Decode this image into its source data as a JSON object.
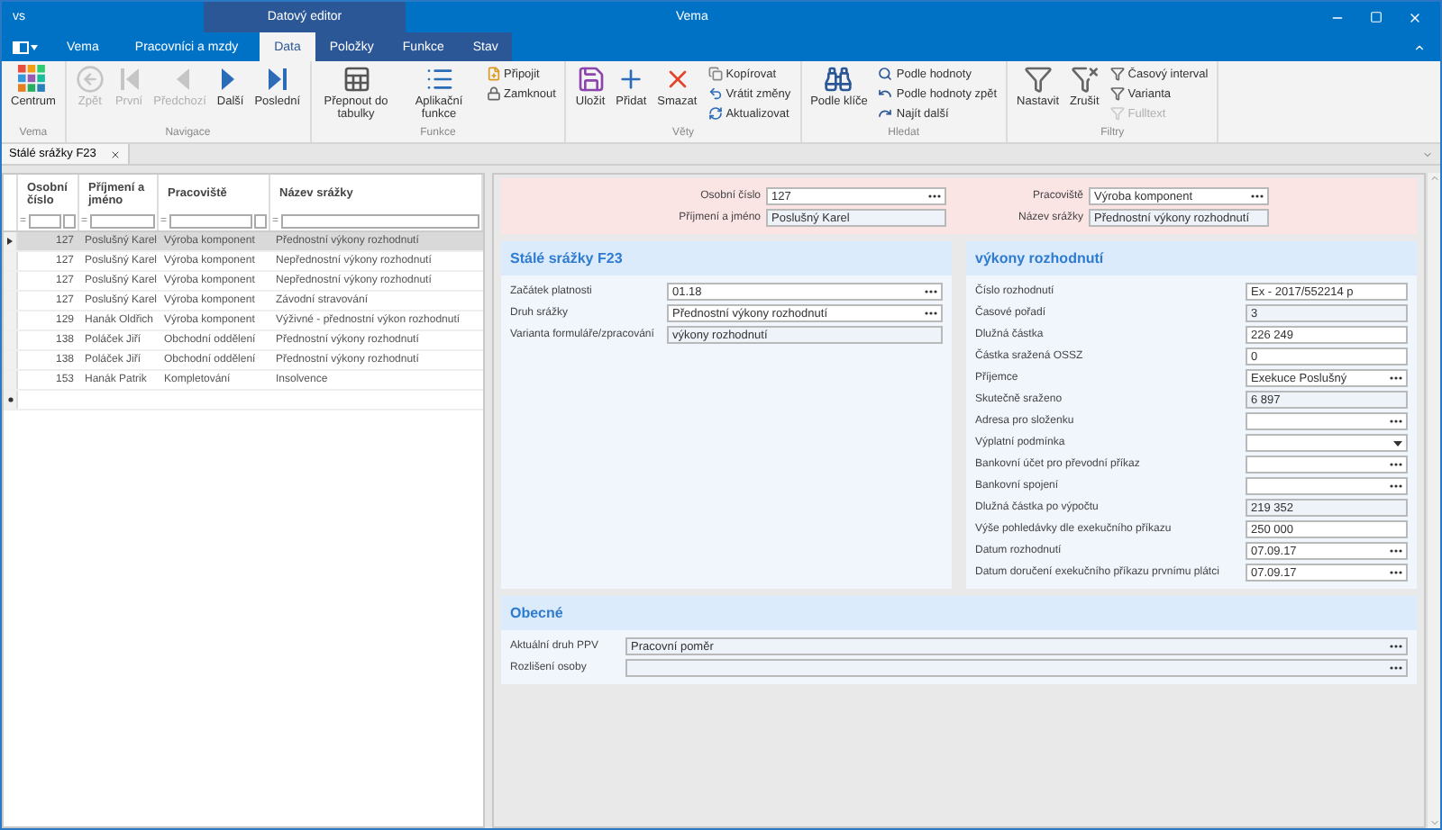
{
  "window": {
    "app": "vs",
    "title": "Vema",
    "context_group": "Datový editor"
  },
  "tabs": [
    {
      "label": "Vema",
      "selected": false,
      "contextual": false
    },
    {
      "label": "Pracovníci a mzdy",
      "selected": false,
      "contextual": false
    },
    {
      "label": "Data",
      "selected": true,
      "contextual": true
    },
    {
      "label": "Položky",
      "selected": false,
      "contextual": true
    },
    {
      "label": "Funkce",
      "selected": false,
      "contextual": true
    },
    {
      "label": "Stav",
      "selected": false,
      "contextual": true
    }
  ],
  "ribbon": [
    {
      "label": "Vema",
      "items": [
        {
          "kind": "large",
          "label": "Centrum",
          "disabled": false
        }
      ]
    },
    {
      "label": "Navigace",
      "items": [
        {
          "kind": "large",
          "label": "Zpět",
          "disabled": true
        },
        {
          "kind": "large",
          "label": "První",
          "disabled": true
        },
        {
          "kind": "large",
          "label": "Předchozí",
          "disabled": true
        },
        {
          "kind": "large",
          "label": "Další",
          "disabled": false
        },
        {
          "kind": "large",
          "label": "Poslední",
          "disabled": false
        }
      ]
    },
    {
      "label": "Funkce",
      "items": [
        {
          "kind": "large",
          "label": "Přepnout do tabulky",
          "disabled": false
        },
        {
          "kind": "large",
          "label": "Aplikační funkce",
          "disabled": false
        },
        {
          "kind": "small",
          "label": "Připojit",
          "disabled": false
        },
        {
          "kind": "small",
          "label": "Zamknout",
          "disabled": false
        }
      ]
    },
    {
      "label": "Věty",
      "items": [
        {
          "kind": "large",
          "label": "Uložit",
          "disabled": false
        },
        {
          "kind": "large",
          "label": "Přidat",
          "disabled": false
        },
        {
          "kind": "large",
          "label": "Smazat",
          "disabled": false
        },
        {
          "kind": "small",
          "label": "Kopírovat",
          "disabled": false
        },
        {
          "kind": "small",
          "label": "Vrátit změny",
          "disabled": false
        },
        {
          "kind": "small",
          "label": "Aktualizovat",
          "disabled": false
        }
      ]
    },
    {
      "label": "Hledat",
      "items": [
        {
          "kind": "large",
          "label": "Podle klíče",
          "disabled": false
        },
        {
          "kind": "small",
          "label": "Podle hodnoty",
          "disabled": false
        },
        {
          "kind": "small",
          "label": "Podle hodnoty zpět",
          "disabled": false
        },
        {
          "kind": "small",
          "label": "Najít další",
          "disabled": false
        }
      ]
    },
    {
      "label": "Filtry",
      "items": [
        {
          "kind": "large",
          "label": "Nastavit",
          "disabled": false
        },
        {
          "kind": "large",
          "label": "Zrušit",
          "disabled": false
        },
        {
          "kind": "small",
          "label": "Časový interval",
          "disabled": false
        },
        {
          "kind": "small",
          "label": "Varianta",
          "disabled": false
        },
        {
          "kind": "small",
          "label": "Fulltext",
          "disabled": true
        }
      ]
    }
  ],
  "document_tab": {
    "label": "Stálé srážky F23"
  },
  "grid": {
    "columns": [
      {
        "label": "Osobní číslo",
        "operator": "=",
        "lookup": true
      },
      {
        "label": "Příjmení a jméno",
        "operator": "=",
        "lookup": false
      },
      {
        "label": "Pracoviště",
        "operator": "=",
        "lookup": true
      },
      {
        "label": "Název srážky",
        "operator": "=",
        "lookup": false
      }
    ],
    "rows": [
      {
        "selected": true,
        "cells": [
          "127",
          "Poslušný Karel",
          "Výroba komponent",
          "Přednostní výkony rozhodnutí"
        ]
      },
      {
        "selected": false,
        "cells": [
          "127",
          "Poslušný Karel",
          "Výroba komponent",
          "Nepřednostní výkony rozhodnutí"
        ]
      },
      {
        "selected": false,
        "cells": [
          "127",
          "Poslušný Karel",
          "Výroba komponent",
          "Nepřednostní výkony rozhodnutí"
        ]
      },
      {
        "selected": false,
        "cells": [
          "127",
          "Poslušný Karel",
          "Výroba komponent",
          "Závodní stravování"
        ]
      },
      {
        "selected": false,
        "cells": [
          "129",
          "Hanák Oldřich",
          "Výroba komponent",
          "Výživné - přednostní výkon rozhodnutí"
        ]
      },
      {
        "selected": false,
        "cells": [
          "138",
          "Poláček Jiří",
          "Obchodní oddělení",
          "Přednostní výkony rozhodnutí"
        ]
      },
      {
        "selected": false,
        "cells": [
          "138",
          "Poláček Jiří",
          "Obchodní oddělení",
          "Přednostní výkony rozhodnutí"
        ]
      },
      {
        "selected": false,
        "cells": [
          "153",
          "Hanák Patrik",
          "Kompletování",
          "Insolvence"
        ]
      }
    ]
  },
  "header_fields": [
    {
      "label": "Osobní číslo",
      "value": "127",
      "kind": "lookup",
      "readonly": false
    },
    {
      "label": "Pracoviště",
      "value": "Výroba komponent",
      "kind": "lookup",
      "readonly": false
    },
    {
      "label": "Příjmení a jméno",
      "value": "Poslušný Karel",
      "kind": "text",
      "readonly": true
    },
    {
      "label": "Název srážky",
      "value": "Přednostní výkony rozhodnutí",
      "kind": "text",
      "readonly": true
    }
  ],
  "sections": [
    {
      "title": "Stálé srážky F23",
      "fields": [
        {
          "label": "Začátek platnosti",
          "value": "01.18",
          "kind": "lookup",
          "readonly": false
        },
        {
          "label": "Druh srážky",
          "value": "Přednostní výkony rozhodnutí",
          "kind": "lookup",
          "readonly": false
        },
        {
          "label": "Varianta formuláře/zpracování",
          "value": "výkony rozhodnutí",
          "kind": "text",
          "readonly": true
        }
      ]
    },
    {
      "title": "výkony rozhodnutí",
      "fields": [
        {
          "label": "Číslo rozhodnutí",
          "value": "Ex - 2017/552214 p",
          "kind": "text",
          "readonly": false
        },
        {
          "label": "Časové pořadí",
          "value": "3",
          "kind": "text",
          "readonly": true
        },
        {
          "label": "Dlužná částka",
          "value": "226 249",
          "kind": "text",
          "readonly": false
        },
        {
          "label": "Částka sražená OSSZ",
          "value": "0",
          "kind": "text",
          "readonly": false
        },
        {
          "label": "Příjemce",
          "value": "Exekuce Poslušný",
          "kind": "lookup",
          "readonly": false
        },
        {
          "label": "Skutečně sraženo",
          "value": "6 897",
          "kind": "text",
          "readonly": true
        },
        {
          "label": "Adresa pro složenku",
          "kind": "lookup",
          "readonly": false
        },
        {
          "label": "Výplatní podmínka",
          "kind": "dropdown",
          "readonly": false
        },
        {
          "label": "Bankovní účet pro převodní příkaz",
          "kind": "lookup",
          "readonly": false
        },
        {
          "label": "Bankovní spojení",
          "kind": "lookup",
          "readonly": false
        },
        {
          "label": "Dlužná částka po výpočtu",
          "value": "219 352",
          "kind": "text",
          "readonly": true
        },
        {
          "label": "Výše pohledávky dle exekučního příkazu",
          "value": "250 000",
          "kind": "text",
          "readonly": false
        },
        {
          "label": "Datum rozhodnutí",
          "value": "07.09.17",
          "kind": "lookup",
          "readonly": false
        },
        {
          "label": "Datum doručení exekučního příkazu prvnímu plátci",
          "value": "07.09.17",
          "kind": "lookup",
          "readonly": false
        }
      ]
    },
    {
      "title": "Obecné",
      "fields": [
        {
          "label": "Aktuální druh PPV",
          "value": "Pracovní poměr",
          "kind": "lookup",
          "readonly": true
        },
        {
          "label": "Rozlišení osoby",
          "kind": "lookup",
          "readonly": true
        }
      ]
    }
  ]
}
